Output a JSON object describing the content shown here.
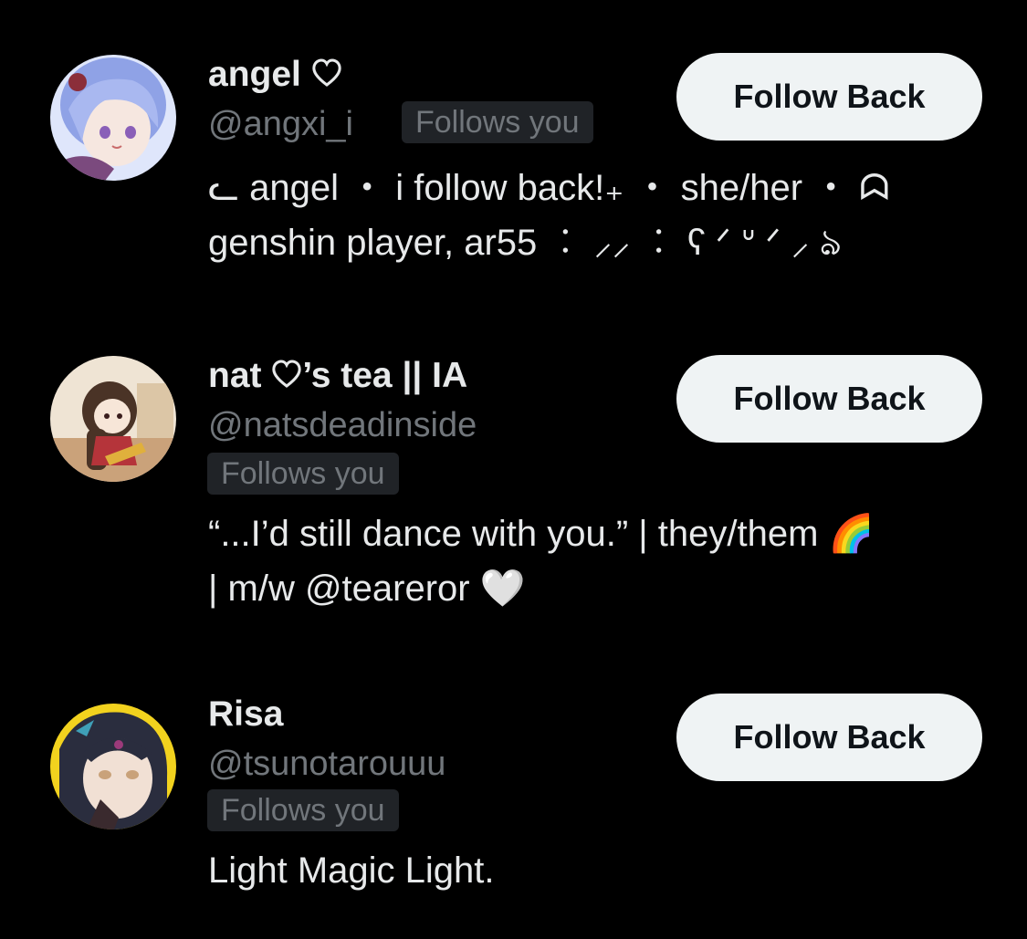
{
  "users": [
    {
      "display_name": "angel",
      "handle": "@angxi_i",
      "follows_you": "Follows you",
      "follow_button": "Follow Back",
      "bio_lines": [
        "ᓚ angel ・ i follow back!₊ ・ she/her ・ ᗣ",
        "genshin player, ar55 ︰ ⸝⸝ ︰ ʕ ᐟ ᐡ ᐟ ⸝ ঌ"
      ],
      "avatar_colors": [
        "#c9d4f5",
        "#7e8fd6",
        "#f3e2dc"
      ]
    },
    {
      "display_name": "nat",
      "display_name_suffix": "’s tea || IA",
      "handle": "@natsdeadinside",
      "follows_you": "Follows you",
      "follow_button": "Follow Back",
      "bio_lines": [
        "“...I’d still dance with you.” | they/them 🌈",
        "| m/w @teareror 🤍"
      ],
      "avatar_colors": [
        "#e8d6c2",
        "#4a3326",
        "#b5343a"
      ]
    },
    {
      "display_name": "Risa",
      "handle": "@tsunotarouuu",
      "follows_you": "Follows you",
      "follow_button": "Follow Back",
      "bio_lines": [
        "Light Magic Light."
      ],
      "avatar_colors": [
        "#f2d21e",
        "#2a2d3e",
        "#c9a27a"
      ]
    }
  ],
  "colors": {
    "background": "#000000",
    "primary_text": "#e7e9ea",
    "secondary_text": "#71767b",
    "badge_bg": "#202327",
    "button_bg": "#eff3f4",
    "button_text": "#0f1419"
  }
}
